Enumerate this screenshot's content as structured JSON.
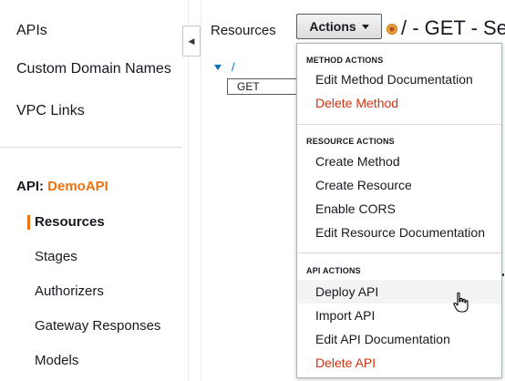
{
  "nav": {
    "top_items": [
      "APIs",
      "Custom Domain Names",
      "VPC Links"
    ],
    "api_prefix": "API:",
    "api_name": "DemoAPI",
    "sub_items": [
      "Resources",
      "Stages",
      "Authorizers",
      "Gateway Responses",
      "Models"
    ],
    "active": "Resources",
    "collapse_glyph": "◀"
  },
  "resources_panel": {
    "title": "Resources",
    "root_path": "/",
    "method": "GET"
  },
  "actions_button": {
    "label": "Actions"
  },
  "method_title": "/ - GET - Se",
  "menu": {
    "sections": [
      {
        "title": "METHOD ACTIONS",
        "items": [
          "Edit Method Documentation",
          "Delete Method"
        ]
      },
      {
        "title": "RESOURCE ACTIONS",
        "items": [
          "Create Method",
          "Create Resource",
          "Enable CORS",
          "Edit Resource Documentation"
        ]
      },
      {
        "title": "API ACTIONS",
        "items": [
          "Deploy API",
          "Import API",
          "Edit API Documentation",
          "Delete API"
        ]
      }
    ],
    "danger_items": [
      "Delete Method",
      "Delete API"
    ],
    "hovered_item": "Deploy API"
  },
  "colors": {
    "accent_orange": "#ec7211",
    "danger_red": "#d13212",
    "link_blue": "#0073bb"
  },
  "cursor_icon": "hand-pointer-icon"
}
